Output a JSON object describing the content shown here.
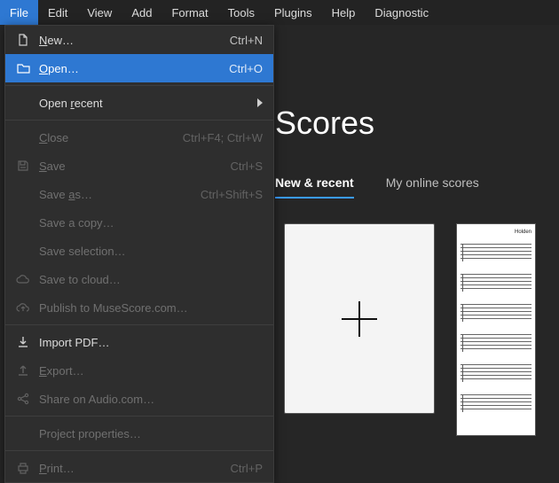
{
  "menubar": {
    "items": [
      {
        "label": "File",
        "active": true
      },
      {
        "label": "Edit"
      },
      {
        "label": "View"
      },
      {
        "label": "Add"
      },
      {
        "label": "Format"
      },
      {
        "label": "Tools"
      },
      {
        "label": "Plugins"
      },
      {
        "label": "Help"
      },
      {
        "label": "Diagnostic"
      }
    ]
  },
  "fileMenu": {
    "new": {
      "label": "New…",
      "shortcut": "Ctrl+N",
      "enabled": true,
      "icon": "file-icon"
    },
    "open": {
      "label": "Open…",
      "shortcut": "Ctrl+O",
      "enabled": true,
      "icon": "folder-icon",
      "highlighted": true
    },
    "openRecent": {
      "label": "Open recent",
      "shortcut": "",
      "enabled": true,
      "submenu": true
    },
    "close": {
      "label": "Close",
      "shortcut": "Ctrl+F4; Ctrl+W",
      "enabled": false
    },
    "save": {
      "label": "Save",
      "shortcut": "Ctrl+S",
      "enabled": false,
      "icon": "save-icon"
    },
    "saveAs": {
      "label": "Save as…",
      "shortcut": "Ctrl+Shift+S",
      "enabled": false
    },
    "saveCopy": {
      "label": "Save a copy…",
      "shortcut": "",
      "enabled": false
    },
    "saveSelection": {
      "label": "Save selection…",
      "shortcut": "",
      "enabled": false
    },
    "saveCloud": {
      "label": "Save to cloud…",
      "shortcut": "",
      "enabled": false,
      "icon": "cloud-icon"
    },
    "publish": {
      "label": "Publish to MuseScore.com…",
      "shortcut": "",
      "enabled": false,
      "icon": "cloud-up-icon"
    },
    "importPdf": {
      "label": "Import PDF…",
      "shortcut": "",
      "enabled": true,
      "icon": "download-icon"
    },
    "export": {
      "label": "Export…",
      "shortcut": "",
      "enabled": false,
      "icon": "upload-icon"
    },
    "shareAudio": {
      "label": "Share on Audio.com…",
      "shortcut": "",
      "enabled": false,
      "icon": "share-icon"
    },
    "projectProps": {
      "label": "Project properties…",
      "shortcut": "",
      "enabled": false
    },
    "print": {
      "label": "Print…",
      "shortcut": "Ctrl+P",
      "enabled": false,
      "icon": "print-icon"
    }
  },
  "page": {
    "title": "Scores",
    "tabs": {
      "newRecent": "New & recent",
      "myOnline": "My online scores"
    },
    "activeTab": "newRecent",
    "sheetTitle": "Holden"
  }
}
